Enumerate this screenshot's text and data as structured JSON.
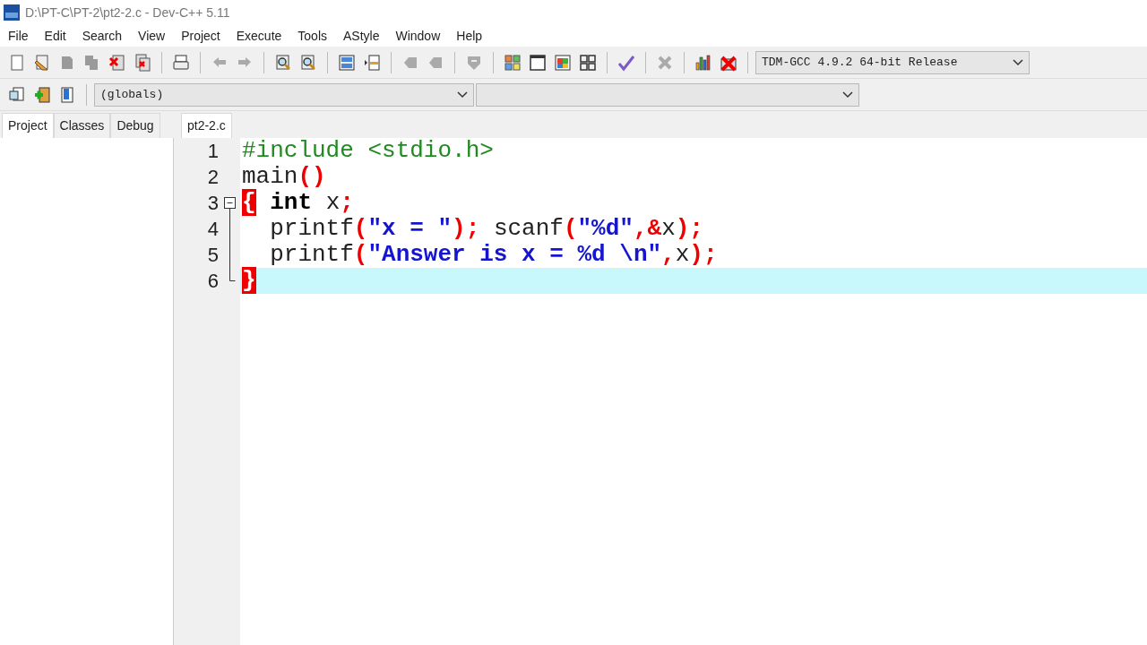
{
  "window": {
    "title": "D:\\PT-C\\PT-2\\pt2-2.c - Dev-C++ 5.11"
  },
  "menu": [
    "File",
    "Edit",
    "Search",
    "View",
    "Project",
    "Execute",
    "Tools",
    "AStyle",
    "Window",
    "Help"
  ],
  "compiler_select": {
    "value": "TDM-GCC 4.9.2 64-bit Release"
  },
  "class_select": {
    "value": "(globals)"
  },
  "panel_tabs": [
    {
      "label": "Project",
      "selected": true
    },
    {
      "label": "Classes",
      "selected": false
    },
    {
      "label": "Debug",
      "selected": false
    }
  ],
  "editor_tabs": [
    {
      "label": "pt2-2.c",
      "selected": true
    }
  ],
  "editor": {
    "lines": [
      {
        "number": "1",
        "current": false,
        "fold_box": false,
        "tokens": [
          {
            "text": "#include <stdio.h>",
            "kind": "preproc"
          }
        ]
      },
      {
        "number": "2",
        "current": false,
        "fold_box": false,
        "tokens": [
          {
            "text": "main",
            "kind": "plain"
          },
          {
            "text": "()",
            "kind": "symbol"
          }
        ]
      },
      {
        "number": "3",
        "current": false,
        "fold_box": true,
        "tokens": [
          {
            "text": "{",
            "kind": "brace"
          },
          {
            "text": " int",
            "kind": "keyword"
          },
          {
            "text": " x",
            "kind": "plain"
          },
          {
            "text": ";",
            "kind": "symbol"
          }
        ]
      },
      {
        "number": "4",
        "current": false,
        "fold_box": false,
        "tokens": [
          {
            "text": "  printf",
            "kind": "plain"
          },
          {
            "text": "(",
            "kind": "symbol"
          },
          {
            "text": "\"x = \"",
            "kind": "string"
          },
          {
            "text": ");",
            "kind": "symbol"
          },
          {
            "text": " scanf",
            "kind": "plain"
          },
          {
            "text": "(",
            "kind": "symbol"
          },
          {
            "text": "\"%d\"",
            "kind": "string"
          },
          {
            "text": ",&",
            "kind": "symbol"
          },
          {
            "text": "x",
            "kind": "plain"
          },
          {
            "text": ");",
            "kind": "symbol"
          }
        ]
      },
      {
        "number": "5",
        "current": false,
        "fold_box": false,
        "tokens": [
          {
            "text": "  printf",
            "kind": "plain"
          },
          {
            "text": "(",
            "kind": "symbol"
          },
          {
            "text": "\"Answer is x = %d \\n\"",
            "kind": "string"
          },
          {
            "text": ",",
            "kind": "symbol"
          },
          {
            "text": "x",
            "kind": "plain"
          },
          {
            "text": ");",
            "kind": "symbol"
          }
        ]
      },
      {
        "number": "6",
        "current": true,
        "fold_box": false,
        "tokens": [
          {
            "text": "}",
            "kind": "brace"
          }
        ]
      }
    ]
  }
}
